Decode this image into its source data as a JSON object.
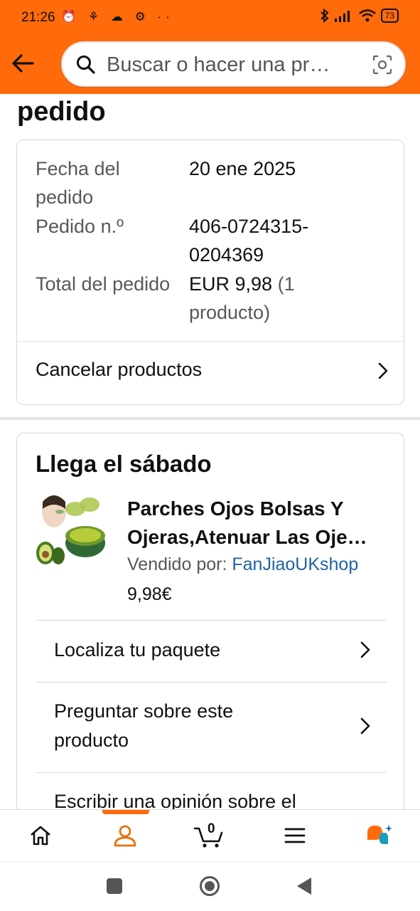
{
  "status_bar": {
    "time": "21:26",
    "left_icons": "⏰ ⚘ ☁ ⚙ ··",
    "battery": "73"
  },
  "header": {
    "search_placeholder": "Buscar o hacer una pr…"
  },
  "page": {
    "title": "pedido"
  },
  "order": {
    "date_label": "Fecha del pedido",
    "date_value": "20 ene 2025",
    "number_label": "Pedido n.º",
    "number_value": "406-0724315-0204369",
    "total_label": "Total del pedido",
    "total_value": "EUR 9,98",
    "total_count": "(1 producto)",
    "cancel_label": "Cancelar productos"
  },
  "shipment": {
    "arrival": "Llega el sábado",
    "product_title_1": "Parches Ojos Bolsas Y",
    "product_title_2": "Ojeras,Atenuar Las Oje…",
    "seller_label": "Vendido por:",
    "seller_name": "FanJiaoUKshop",
    "price": "9,98€",
    "actions": {
      "track": "Localiza tu paquete",
      "ask": "Preguntar sobre este producto",
      "review": "Escribir una opinión sobre el"
    }
  },
  "bottom_nav": {
    "cart_count": "0",
    "active": "account"
  },
  "colors": {
    "brand": "#ff6a0a",
    "link": "#2162a1"
  }
}
